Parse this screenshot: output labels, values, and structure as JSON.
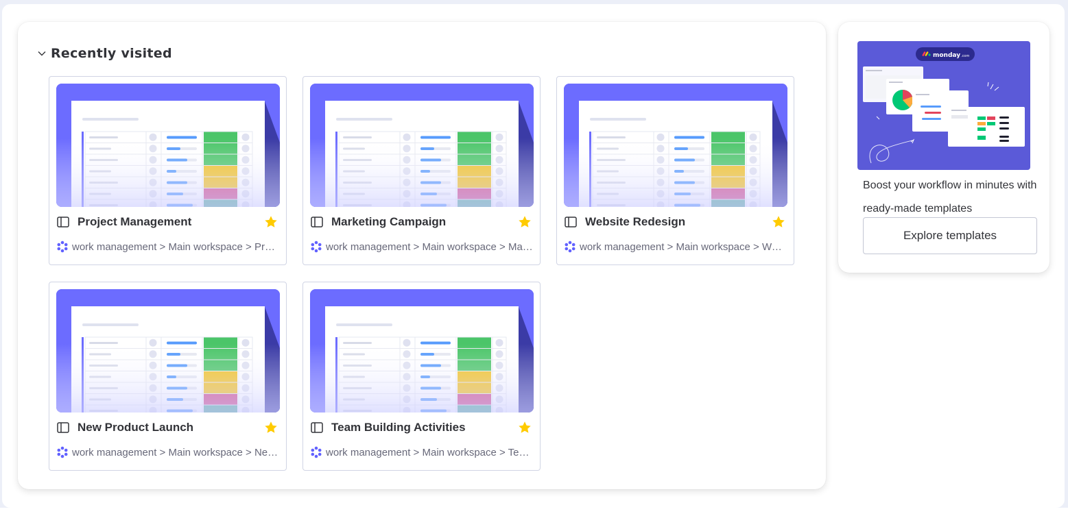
{
  "recently_visited": {
    "title": "Recently visited",
    "cards": [
      {
        "title": "Project Management",
        "path": "work management > Main workspace > Project Management",
        "starred": true
      },
      {
        "title": "Marketing Campaign",
        "path": "work management > Main workspace > Marketing Campaign",
        "starred": true
      },
      {
        "title": "Website Redesign",
        "path": "work management > Main workspace > Website Redesign",
        "starred": true
      },
      {
        "title": "New Product Launch",
        "path": "work management > Main workspace > New Product Launch",
        "starred": true
      },
      {
        "title": "Team Building Activities",
        "path": "work management > Main workspace > Team Building Activities",
        "starred": true
      }
    ]
  },
  "templates": {
    "brand_label": "monday",
    "brand_suffix": ".com",
    "promo_text": "Boost your workflow in minutes with ready-made templates",
    "button_label": "Explore templates"
  },
  "colors": {
    "thumb_bg": "#6c6cff",
    "status_green": "#4bc569",
    "status_yellow": "#f2c120",
    "status_pink": "#d1478a",
    "status_teal": "#56ab9a",
    "star": "#ffcb00",
    "promo_bg": "#5b5ad8"
  },
  "icons": {
    "section_toggle": "chevron-down-icon",
    "board": "board-icon",
    "favorite": "star-icon",
    "workspace": "work-management-icon"
  }
}
